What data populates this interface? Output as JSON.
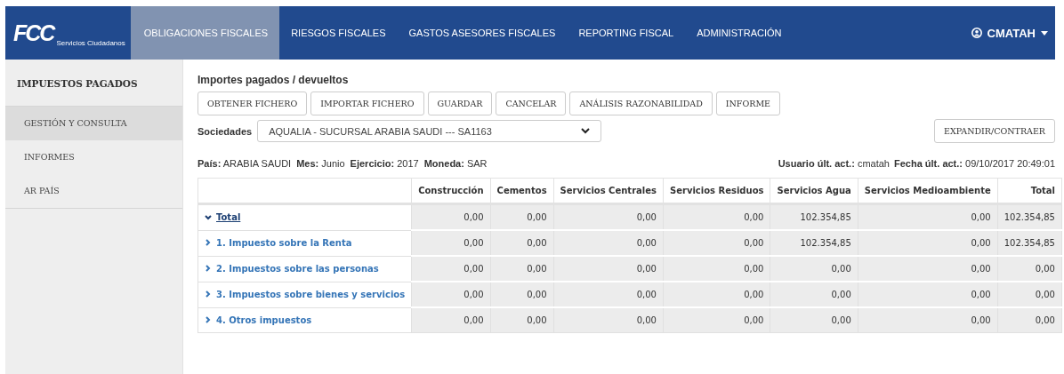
{
  "header": {
    "logo": {
      "mark": "FCC",
      "tagline": "Servicios Ciudadanos"
    },
    "nav": [
      {
        "label": "OBLIGACIONES FISCALES",
        "selected": true
      },
      {
        "label": "RIESGOS FISCALES",
        "selected": false
      },
      {
        "label": "GASTOS ASESORES FISCALES",
        "selected": false
      },
      {
        "label": "REPORTING FISCAL",
        "selected": false
      },
      {
        "label": "ADMINISTRACIÓN",
        "selected": false
      }
    ],
    "user": "CMATAH"
  },
  "sidebar": {
    "title": "IMPUESTOS PAGADOS",
    "items": [
      {
        "label": "GESTIÓN Y CONSULTA",
        "selected": true
      },
      {
        "label": "INFORMES",
        "selected": false
      },
      {
        "label": "AR PAÍS",
        "selected": false
      }
    ]
  },
  "main": {
    "title": "Importes pagados / devueltos",
    "buttons": [
      "OBTENER FICHERO",
      "IMPORTAR FICHERO",
      "GUARDAR",
      "CANCELAR",
      "ANÁLISIS RAZONABILIDAD",
      "INFORME"
    ],
    "company": {
      "label": "Sociedades",
      "value": "AQUALIA - SUCURSAL ARABIA SAUDI --- SA1163"
    },
    "expand_button": "EXPANDIR/CONTRAER",
    "info": [
      {
        "label": "País:",
        "value": "ARABIA SAUDI"
      },
      {
        "label": "Mes:",
        "value": "Junio"
      },
      {
        "label": "Ejercicio:",
        "value": "2017"
      },
      {
        "label": "Moneda:",
        "value": "SAR"
      }
    ],
    "audit": [
      {
        "label": "Usuario últ. act.:",
        "value": "cmatah"
      },
      {
        "label": "Fecha últ. act.:",
        "value": "09/10/2017 20:49:01"
      }
    ],
    "table": {
      "columns": [
        "Construcción",
        "Cementos",
        "Servicios Centrales",
        "Servicios Residuos",
        "Servicios Agua",
        "Servicios Medioambiente",
        "Total"
      ],
      "rows": [
        {
          "kind": "total",
          "label": "Total",
          "expanded": true,
          "values": [
            "0,00",
            "0,00",
            "0,00",
            "0,00",
            "102.354,85",
            "0,00",
            "102.354,85"
          ]
        },
        {
          "kind": "category",
          "label": "1. Impuesto sobre la Renta",
          "expanded": false,
          "values": [
            "0,00",
            "0,00",
            "0,00",
            "0,00",
            "102.354,85",
            "0,00",
            "102.354,85"
          ]
        },
        {
          "kind": "category",
          "label": "2. Impuestos sobre las personas",
          "expanded": false,
          "values": [
            "0,00",
            "0,00",
            "0,00",
            "0,00",
            "0,00",
            "0,00",
            "0,00"
          ]
        },
        {
          "kind": "category",
          "label": "3. Impuestos sobre bienes y servicios",
          "expanded": false,
          "values": [
            "0,00",
            "0,00",
            "0,00",
            "0,00",
            "0,00",
            "0,00",
            "0,00"
          ]
        },
        {
          "kind": "category",
          "label": "4. Otros impuestos",
          "expanded": false,
          "values": [
            "0,00",
            "0,00",
            "0,00",
            "0,00",
            "0,00",
            "0,00",
            "0,00"
          ]
        }
      ]
    }
  }
}
